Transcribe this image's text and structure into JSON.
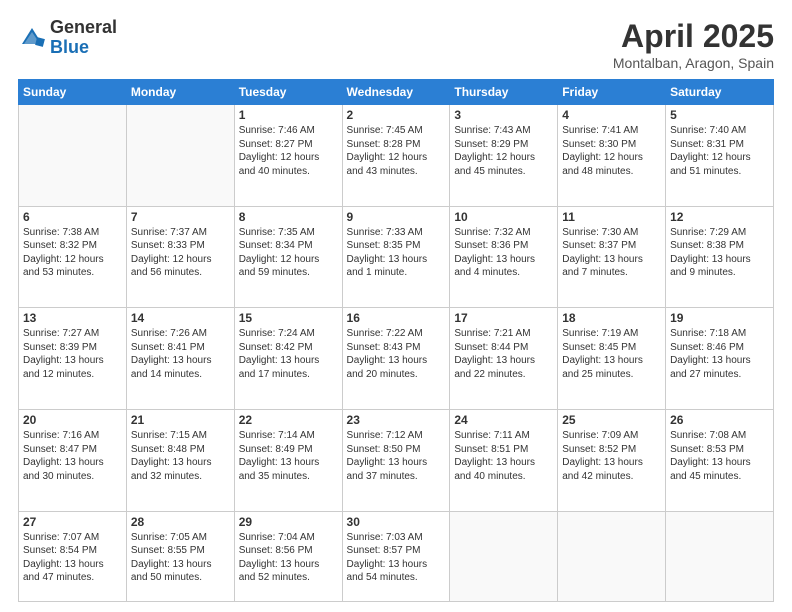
{
  "logo": {
    "general": "General",
    "blue": "Blue"
  },
  "title": {
    "month": "April 2025",
    "location": "Montalban, Aragon, Spain"
  },
  "weekdays": [
    "Sunday",
    "Monday",
    "Tuesday",
    "Wednesday",
    "Thursday",
    "Friday",
    "Saturday"
  ],
  "weeks": [
    [
      {
        "day": "",
        "text": ""
      },
      {
        "day": "",
        "text": ""
      },
      {
        "day": "1",
        "text": "Sunrise: 7:46 AM\nSunset: 8:27 PM\nDaylight: 12 hours and 40 minutes."
      },
      {
        "day": "2",
        "text": "Sunrise: 7:45 AM\nSunset: 8:28 PM\nDaylight: 12 hours and 43 minutes."
      },
      {
        "day": "3",
        "text": "Sunrise: 7:43 AM\nSunset: 8:29 PM\nDaylight: 12 hours and 45 minutes."
      },
      {
        "day": "4",
        "text": "Sunrise: 7:41 AM\nSunset: 8:30 PM\nDaylight: 12 hours and 48 minutes."
      },
      {
        "day": "5",
        "text": "Sunrise: 7:40 AM\nSunset: 8:31 PM\nDaylight: 12 hours and 51 minutes."
      }
    ],
    [
      {
        "day": "6",
        "text": "Sunrise: 7:38 AM\nSunset: 8:32 PM\nDaylight: 12 hours and 53 minutes."
      },
      {
        "day": "7",
        "text": "Sunrise: 7:37 AM\nSunset: 8:33 PM\nDaylight: 12 hours and 56 minutes."
      },
      {
        "day": "8",
        "text": "Sunrise: 7:35 AM\nSunset: 8:34 PM\nDaylight: 12 hours and 59 minutes."
      },
      {
        "day": "9",
        "text": "Sunrise: 7:33 AM\nSunset: 8:35 PM\nDaylight: 13 hours and 1 minute."
      },
      {
        "day": "10",
        "text": "Sunrise: 7:32 AM\nSunset: 8:36 PM\nDaylight: 13 hours and 4 minutes."
      },
      {
        "day": "11",
        "text": "Sunrise: 7:30 AM\nSunset: 8:37 PM\nDaylight: 13 hours and 7 minutes."
      },
      {
        "day": "12",
        "text": "Sunrise: 7:29 AM\nSunset: 8:38 PM\nDaylight: 13 hours and 9 minutes."
      }
    ],
    [
      {
        "day": "13",
        "text": "Sunrise: 7:27 AM\nSunset: 8:39 PM\nDaylight: 13 hours and 12 minutes."
      },
      {
        "day": "14",
        "text": "Sunrise: 7:26 AM\nSunset: 8:41 PM\nDaylight: 13 hours and 14 minutes."
      },
      {
        "day": "15",
        "text": "Sunrise: 7:24 AM\nSunset: 8:42 PM\nDaylight: 13 hours and 17 minutes."
      },
      {
        "day": "16",
        "text": "Sunrise: 7:22 AM\nSunset: 8:43 PM\nDaylight: 13 hours and 20 minutes."
      },
      {
        "day": "17",
        "text": "Sunrise: 7:21 AM\nSunset: 8:44 PM\nDaylight: 13 hours and 22 minutes."
      },
      {
        "day": "18",
        "text": "Sunrise: 7:19 AM\nSunset: 8:45 PM\nDaylight: 13 hours and 25 minutes."
      },
      {
        "day": "19",
        "text": "Sunrise: 7:18 AM\nSunset: 8:46 PM\nDaylight: 13 hours and 27 minutes."
      }
    ],
    [
      {
        "day": "20",
        "text": "Sunrise: 7:16 AM\nSunset: 8:47 PM\nDaylight: 13 hours and 30 minutes."
      },
      {
        "day": "21",
        "text": "Sunrise: 7:15 AM\nSunset: 8:48 PM\nDaylight: 13 hours and 32 minutes."
      },
      {
        "day": "22",
        "text": "Sunrise: 7:14 AM\nSunset: 8:49 PM\nDaylight: 13 hours and 35 minutes."
      },
      {
        "day": "23",
        "text": "Sunrise: 7:12 AM\nSunset: 8:50 PM\nDaylight: 13 hours and 37 minutes."
      },
      {
        "day": "24",
        "text": "Sunrise: 7:11 AM\nSunset: 8:51 PM\nDaylight: 13 hours and 40 minutes."
      },
      {
        "day": "25",
        "text": "Sunrise: 7:09 AM\nSunset: 8:52 PM\nDaylight: 13 hours and 42 minutes."
      },
      {
        "day": "26",
        "text": "Sunrise: 7:08 AM\nSunset: 8:53 PM\nDaylight: 13 hours and 45 minutes."
      }
    ],
    [
      {
        "day": "27",
        "text": "Sunrise: 7:07 AM\nSunset: 8:54 PM\nDaylight: 13 hours and 47 minutes."
      },
      {
        "day": "28",
        "text": "Sunrise: 7:05 AM\nSunset: 8:55 PM\nDaylight: 13 hours and 50 minutes."
      },
      {
        "day": "29",
        "text": "Sunrise: 7:04 AM\nSunset: 8:56 PM\nDaylight: 13 hours and 52 minutes."
      },
      {
        "day": "30",
        "text": "Sunrise: 7:03 AM\nSunset: 8:57 PM\nDaylight: 13 hours and 54 minutes."
      },
      {
        "day": "",
        "text": ""
      },
      {
        "day": "",
        "text": ""
      },
      {
        "day": "",
        "text": ""
      }
    ]
  ]
}
